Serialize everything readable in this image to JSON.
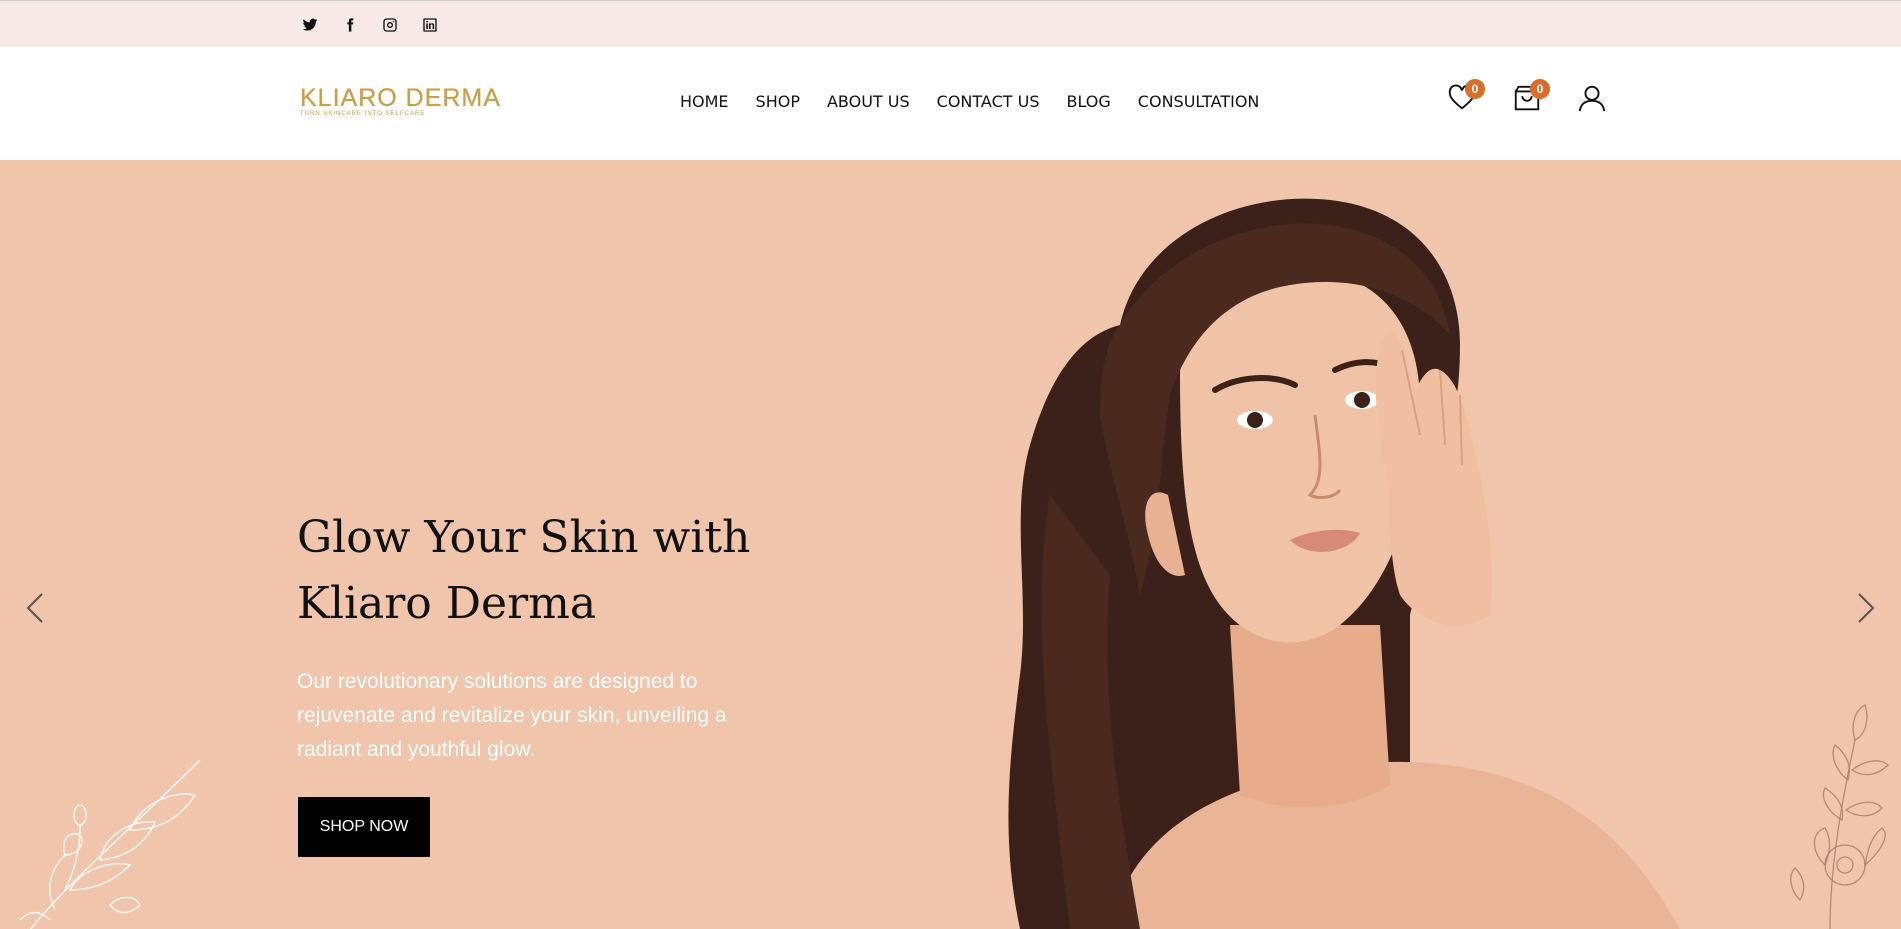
{
  "social": {
    "items": [
      {
        "icon": "twitter-icon"
      },
      {
        "icon": "facebook-icon"
      },
      {
        "icon": "instagram-icon"
      },
      {
        "icon": "linkedin-icon"
      }
    ]
  },
  "header": {
    "logo_text": "KLIARO DERMA",
    "logo_tagline": "TURN SKINCARE INTO SELFCARE",
    "nav": [
      "HOME",
      "SHOP",
      "ABOUT US",
      "CONTACT US",
      "BLOG",
      "CONSULTATION"
    ],
    "wishlist_count": "0",
    "cart_count": "0"
  },
  "hero": {
    "title_line1": "Glow Your Skin with",
    "title_line2": "Kliaro Derma",
    "text": "Our revolutionary solutions are designed to rejuvenate and revitalize your skin, unveiling a radiant and youthful glow.",
    "button_label": "SHOP NOW"
  },
  "colors": {
    "topbar_bg": "#f6e9e6",
    "hero_bg": "#f0c5ab",
    "badge": "#d96d2b",
    "logo_gold": "#c9a04a",
    "button_bg": "#000000"
  }
}
